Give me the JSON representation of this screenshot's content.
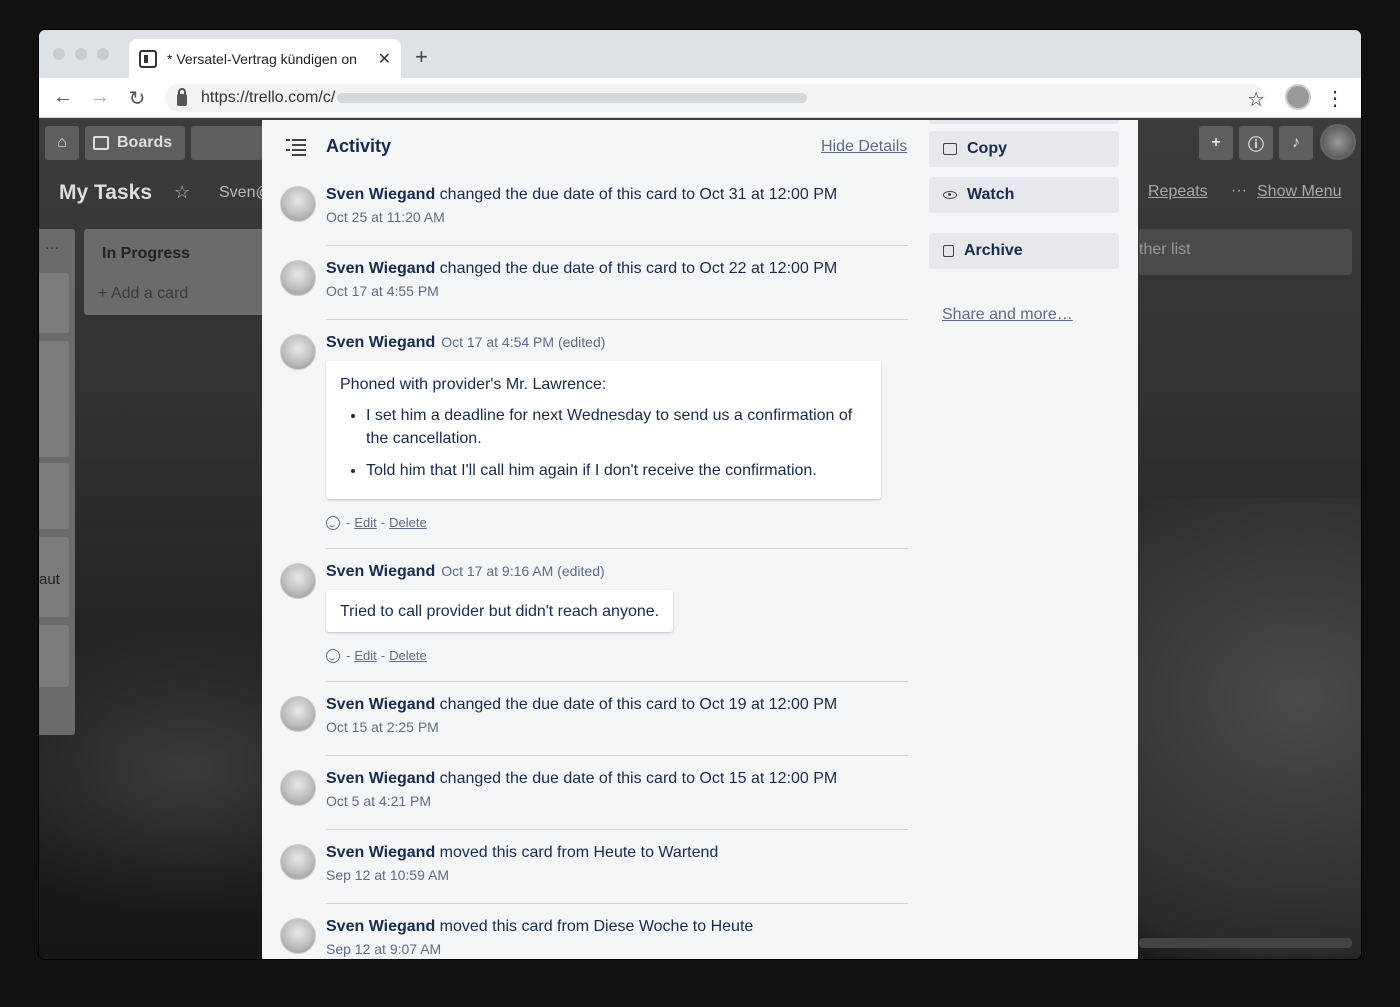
{
  "browser": {
    "tab_title": "* Versatel-Vertrag kündigen on",
    "url": "https://trello.com/c/",
    "new_tab": "+",
    "close": "✕"
  },
  "board": {
    "boards_label": "Boards",
    "title": "My Tasks",
    "subtitle": "Sven@",
    "list_title": "In Progress",
    "add_card": "+ Add a card",
    "left_fragment": "aut",
    "repeats": "Repeats",
    "show_menu": "Show Menu",
    "another_list": "ther list"
  },
  "modal": {
    "activity_title": "Activity",
    "hide_details": "Hide Details",
    "entries": [
      {
        "author": "Sven Wiegand",
        "action": " changed the due date of this card to Oct 31 at 12:00 PM",
        "date": "Oct 25 at 11:20 AM"
      },
      {
        "author": "Sven Wiegand",
        "action": " changed the due date of this card to Oct 22 at 12:00 PM",
        "date": "Oct 17 at 4:55 PM"
      },
      {
        "author": "Sven Wiegand",
        "meta": "Oct 17 at 4:54 PM (edited)",
        "comment_intro": "Phoned with provider's Mr. Lawrence:",
        "bullets": [
          "I set him a deadline for next Wednesday to send us a confirmation of the cancellation.",
          "Told him that I'll call him again if I don't receive the confirmation."
        ],
        "edit": "Edit",
        "delete": "Delete"
      },
      {
        "author": "Sven Wiegand",
        "meta": "Oct 17 at 9:16 AM (edited)",
        "comment": "Tried to call provider but didn't reach anyone.",
        "edit": "Edit",
        "delete": "Delete"
      },
      {
        "author": "Sven Wiegand",
        "action": " changed the due date of this card to Oct 19 at 12:00 PM",
        "date": "Oct 15 at 2:25 PM"
      },
      {
        "author": "Sven Wiegand",
        "action": " changed the due date of this card to Oct 15 at 12:00 PM",
        "date": "Oct 5 at 4:21 PM"
      },
      {
        "author": "Sven Wiegand",
        "action": " moved this card from Heute to Wartend",
        "date": "Sep 12 at 10:59 AM"
      },
      {
        "author": "Sven Wiegand",
        "action": " moved this card from Diese Woche to Heute",
        "date": "Sep 12 at 9:07 AM"
      }
    ],
    "separator": "-"
  },
  "sidebar": {
    "copy": "Copy",
    "watch": "Watch",
    "archive": "Archive",
    "share": "Share and more…"
  }
}
